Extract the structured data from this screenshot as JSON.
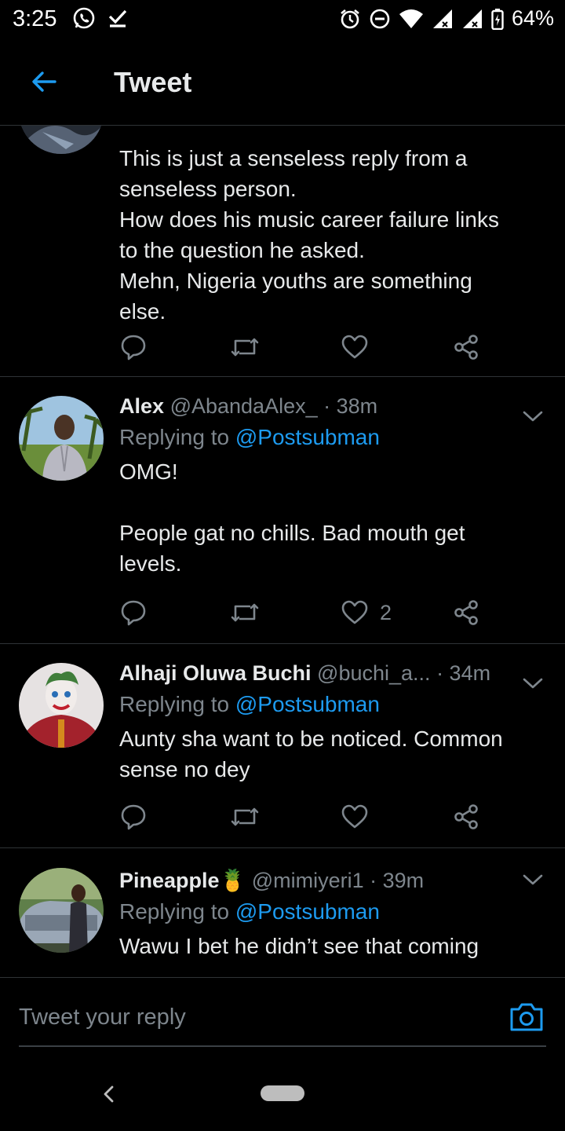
{
  "status_bar": {
    "time": "3:25",
    "battery_percent": "64%",
    "left_icons": [
      "whatsapp-icon",
      "check-icon"
    ],
    "right_icons": [
      "alarm-icon",
      "dnd-icon",
      "wifi-icon",
      "signal-icon",
      "signal-icon",
      "battery-charging-icon"
    ]
  },
  "header": {
    "title": "Tweet"
  },
  "tweets": [
    {
      "text": "This is just a senseless reply from a\nsenseless person.\nHow does his music career failure links\nto the question he asked.\nMehn, Nigeria youths are something\nelse.",
      "like_count": ""
    },
    {
      "name": "Alex",
      "handle": "@AbandaAlex_",
      "time": "· 38m",
      "replying_label": "Replying to",
      "replying_to": "@Postsubman",
      "text": "OMG!\n\nPeople gat no chills. Bad mouth get\nlevels.",
      "like_count": "2"
    },
    {
      "name": "Alhaji Oluwa Buchi",
      "handle": "@buchi_a...",
      "time": "· 34m",
      "replying_label": "Replying to",
      "replying_to": "@Postsubman",
      "text": "Aunty sha want to be noticed. Common\nsense no dey",
      "like_count": ""
    },
    {
      "name": "Pineapple",
      "name_emoji": "🍍",
      "handle": "@mimiyeri1",
      "time": "· 39m",
      "replying_label": "Replying to",
      "replying_to": "@Postsubman",
      "text": "Wawu I bet he didn’t see that coming"
    }
  ],
  "reply_bar": {
    "placeholder": "Tweet your reply"
  },
  "colors": {
    "background": "#000000",
    "accent": "#1d9bf0",
    "muted_text": "#7e868d",
    "divider": "#2f3336"
  }
}
